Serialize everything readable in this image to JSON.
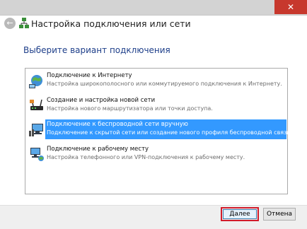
{
  "window": {
    "title": "Настройка подключения или сети",
    "close_glyph": "✕",
    "back_glyph": "←"
  },
  "heading": "Выберите вариант подключения",
  "options": [
    {
      "title": "Подключение к Интернету",
      "description": "Настройка широкополосного или коммутируемого подключения к Интернету.",
      "icon": "globe-network-icon",
      "selected": false
    },
    {
      "title": "Создание и настройка новой сети",
      "description": "Настройка нового маршрутизатора или точки доступа.",
      "icon": "router-icon",
      "selected": false
    },
    {
      "title": "Подключение к беспроводной сети вручную",
      "description": "Подключение к скрытой сети или создание нового профиля беспроводной связи.",
      "icon": "wireless-computer-icon",
      "selected": true
    },
    {
      "title": "Подключение к рабочему месту",
      "description": "Настройка телефонного или VPN-подключения к рабочему месту.",
      "icon": "workplace-network-icon",
      "selected": false
    }
  ],
  "buttons": {
    "next": "Далее",
    "cancel": "Отмена"
  },
  "colors": {
    "selection": "#3399ff",
    "heading": "#1e3f8a",
    "close": "#c7382d",
    "highlight_outline": "#d11a2a"
  }
}
